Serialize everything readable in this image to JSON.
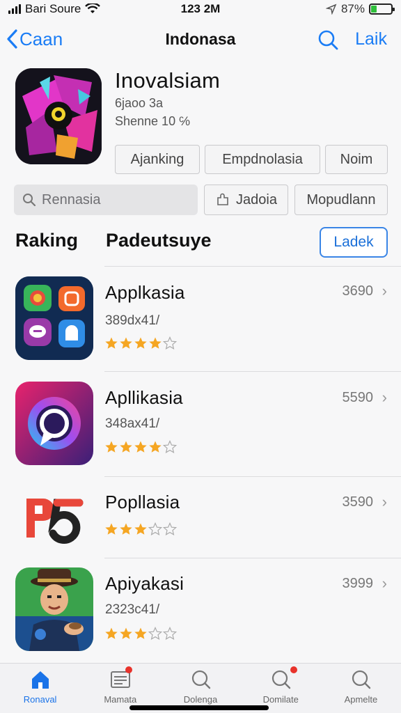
{
  "status_bar": {
    "carrier": "Bari Soure",
    "time": "123 2M",
    "battery": "87%",
    "battery_level": 0.3
  },
  "nav": {
    "back_label": "Caan",
    "title": "Indonasa",
    "right_label": "Laik"
  },
  "hero": {
    "title": "Inovalsiam",
    "subtitle1": "6jaoo 3a",
    "subtitle2": "Shenne 10 ℅",
    "buttons": [
      "Ajanking",
      "Empdnolasia",
      "Noim"
    ],
    "search_placeholder": "Rennasia",
    "buttons2": [
      "Jadoia",
      "Mopudlann"
    ]
  },
  "section": {
    "title_left": "Raking",
    "title_right": "Padeutsuye",
    "action": "Ladek"
  },
  "apps": [
    {
      "name": "Applkasia",
      "sub": "389dx41/",
      "price": "3690",
      "rating": 4
    },
    {
      "name": "Apllikasia",
      "sub": "348ax41/",
      "price": "5590",
      "rating": 4
    },
    {
      "name": "Popllasia",
      "sub": "",
      "price": "3590",
      "rating": 3
    },
    {
      "name": "Apiyakasi",
      "sub": "2323c41/",
      "price": "3999",
      "rating": 3
    }
  ],
  "tabs": [
    {
      "label": "Ronaval",
      "icon": "home-icon",
      "active": true
    },
    {
      "label": "Mamata",
      "icon": "list-icon",
      "badge": true
    },
    {
      "label": "Dolenga",
      "icon": "search-icon"
    },
    {
      "label": "Domilate",
      "icon": "search-badge-icon",
      "badge": true
    },
    {
      "label": "Apmelte",
      "icon": "search-icon"
    }
  ],
  "colors": {
    "accent": "#1a7cf5",
    "star": "#f5a623",
    "badge": "#e8322b"
  }
}
